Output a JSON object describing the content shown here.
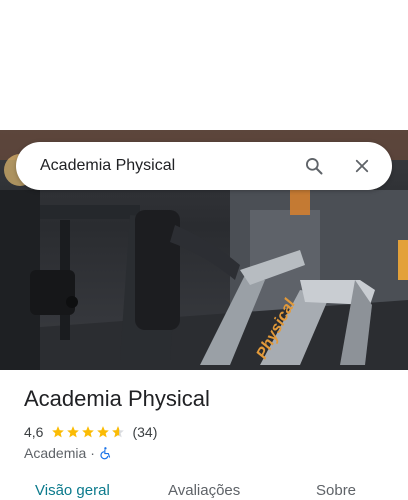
{
  "search": {
    "value": "Academia Physical",
    "search_icon": "search-icon",
    "close_icon": "close-icon"
  },
  "place": {
    "name": "Academia Physical",
    "rating": "4,6",
    "rating_value": 4.6,
    "reviews_count": "(34)",
    "category": "Academia",
    "separator": "·",
    "accessibility_icon": "wheelchair-icon"
  },
  "photo": {
    "overlay_text": "Physical"
  },
  "tabs": [
    {
      "label": "Visão geral",
      "active": true
    },
    {
      "label": "Avaliações",
      "active": false
    },
    {
      "label": "Sobre",
      "active": false
    }
  ],
  "colors": {
    "star": "#fbbc04",
    "active_tab": "#0b7a8c",
    "accessibility": "#1a73e8"
  }
}
